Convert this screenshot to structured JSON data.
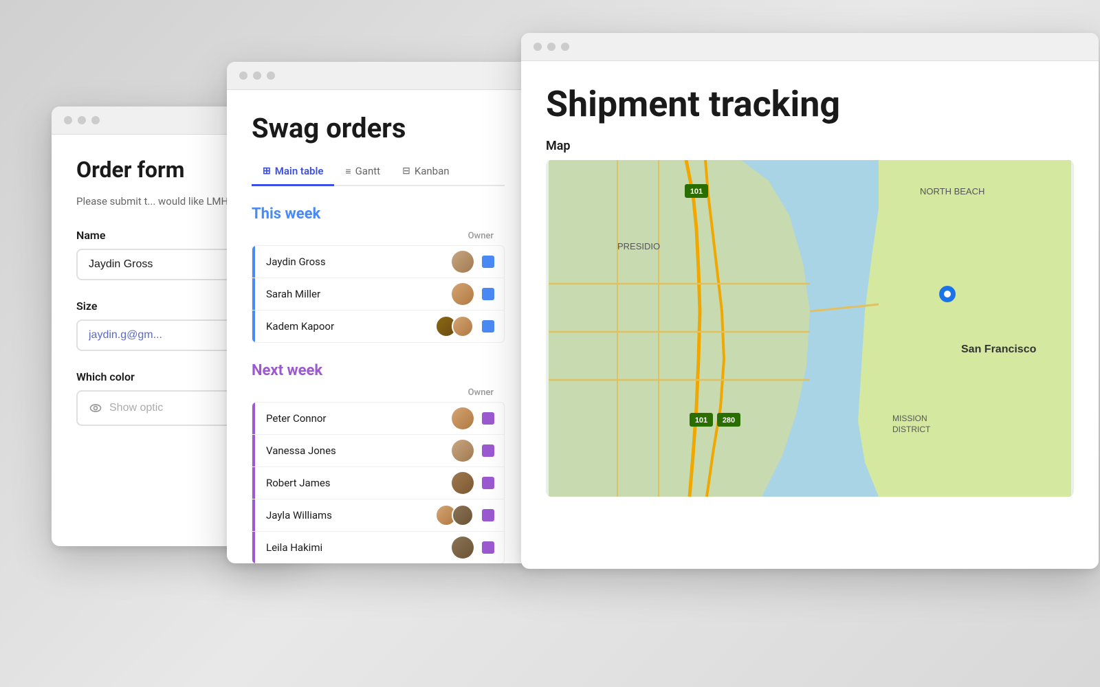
{
  "scene": {
    "background_color": "#d8d8d8"
  },
  "order_form": {
    "title": "Order form",
    "description": "Please submit t... would like LMH s...",
    "name_label": "Name",
    "name_value": "Jaydin Gross",
    "size_label": "Size",
    "size_value": "jaydin.g@gm...",
    "color_label": "Which color",
    "show_options_label": "Show optic"
  },
  "swag_orders": {
    "title": "Swag orders",
    "tabs": [
      {
        "label": "Main table",
        "icon": "⊞",
        "active": true
      },
      {
        "label": "Gantt",
        "icon": "≡",
        "active": false
      },
      {
        "label": "Kanban",
        "icon": "⊟",
        "active": false
      }
    ],
    "this_week": {
      "header": "This week",
      "owner_col": "Owner",
      "rows": [
        {
          "name": "Jaydin Gross",
          "avatar_type": "single",
          "av": "av1"
        },
        {
          "name": "Sarah Miller",
          "avatar_type": "single",
          "av": "av2"
        },
        {
          "name": "Kadem Kapoor",
          "avatar_type": "multi",
          "av1": "av3",
          "av2": "av4"
        }
      ]
    },
    "next_week": {
      "header": "Next week",
      "owner_col": "Owner",
      "rows": [
        {
          "name": "Peter Connor",
          "avatar_type": "single",
          "av": "av4"
        },
        {
          "name": "Vanessa Jones",
          "avatar_type": "single",
          "av": "av5"
        },
        {
          "name": "Robert James",
          "avatar_type": "single",
          "av": "av6"
        },
        {
          "name": "Jayla Williams",
          "avatar_type": "multi",
          "av1": "av7",
          "av2": "av8"
        },
        {
          "name": "Leila Hakimi",
          "avatar_type": "single",
          "av": "av8"
        }
      ]
    }
  },
  "shipment_tracking": {
    "title": "Shipment tracking",
    "map_label": "Map"
  }
}
